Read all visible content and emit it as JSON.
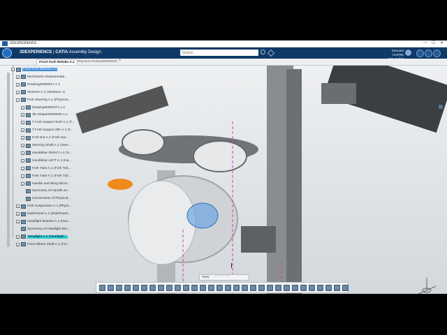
{
  "window": {
    "title": "3DEXPERIENCE",
    "controls": [
      "—",
      "☐",
      "✕"
    ]
  },
  "appbar": {
    "brand_prefix": "3DEXPERIENCE",
    "brand_sep": " | ",
    "app": "CATIA",
    "module": "Assembly Design",
    "search_placeholder": "Search",
    "user_name": "Edouard DUPRE",
    "user_space": "3DS Collab Space"
  },
  "tabs": [
    {
      "label": "Front Fork R2018x A.1"
    },
    {
      "label": "Physical Product00000191"
    }
  ],
  "tree": [
    {
      "label": "Front Fork R2018x A.1",
      "indent": 0,
      "state": "sel-blue",
      "expand": "−"
    },
    {
      "label": "Mechanism Representati...",
      "indent": 1,
      "state": "",
      "expand": "+"
    },
    {
      "label": "Drawing00000017 A.1",
      "indent": 1,
      "state": "",
      "expand": "+"
    },
    {
      "label": "Skeleton A.1 (Skeleton 1)",
      "indent": 1,
      "state": "",
      "expand": "+"
    },
    {
      "label": "Fork Steering A.1 (Physical...",
      "indent": 1,
      "state": "",
      "expand": "−"
    },
    {
      "label": "Drawing00000071 A.1",
      "indent": 2,
      "state": "",
      "expand": "+"
    },
    {
      "label": "3D Shape00000290 A.1",
      "indent": 2,
      "state": "",
      "expand": "+"
    },
    {
      "label": "T Fork Support SUP A.1 (T...",
      "indent": 2,
      "state": "",
      "expand": "+"
    },
    {
      "label": "T Fork Support INF A.1 (T...",
      "indent": 2,
      "state": "",
      "expand": "+"
    },
    {
      "label": "Fork Nut A.1 (Fork Nut...",
      "indent": 2,
      "state": "",
      "expand": "+"
    },
    {
      "label": "Steering Shaft A.1 (Stee...",
      "indent": 2,
      "state": "",
      "expand": "+"
    },
    {
      "label": "Handlebar RIGHT A.1 (H...",
      "indent": 2,
      "state": "",
      "expand": "+"
    },
    {
      "label": "Handlebar LEFT A.1 (Ha...",
      "indent": 2,
      "state": "",
      "expand": "+"
    },
    {
      "label": "Fork Tube A.1 (Fork Tub...",
      "indent": 2,
      "state": "",
      "expand": "+"
    },
    {
      "label": "Fork Tube A.1 (Fork Tub...",
      "indent": 2,
      "state": "",
      "expand": "+"
    },
    {
      "label": "Handle and Wing Mirror...",
      "indent": 2,
      "state": "",
      "expand": "+"
    },
    {
      "label": "Symmetry of Handle an...",
      "indent": 2,
      "state": "",
      "expand": ""
    },
    {
      "label": "Connections of Physical...",
      "indent": 2,
      "state": "",
      "expand": ""
    },
    {
      "label": "Fork Suspension A.1 (Physi...",
      "indent": 1,
      "state": "",
      "expand": "+"
    },
    {
      "label": "DashPanel A.1 (DashPanel...",
      "indent": 1,
      "state": "",
      "expand": "+"
    },
    {
      "label": "Headlight Bracket A.1 (Hea...",
      "indent": 1,
      "state": "",
      "expand": "+"
    },
    {
      "label": "Symmetry of Headlight Bra...",
      "indent": 1,
      "state": "",
      "expand": ""
    },
    {
      "label": "Headlight A.1 (Headlight...",
      "indent": 1,
      "state": "sel-cyan",
      "expand": "+"
    },
    {
      "label": "Front Wheel Shaft A.1 (Fro...",
      "indent": 1,
      "state": "",
      "expand": "+"
    }
  ],
  "subbar": {
    "label": "View"
  },
  "colors": {
    "accent": "#0f3a68",
    "selection": "#3f8fd9",
    "highlight": "#36d6d2"
  }
}
